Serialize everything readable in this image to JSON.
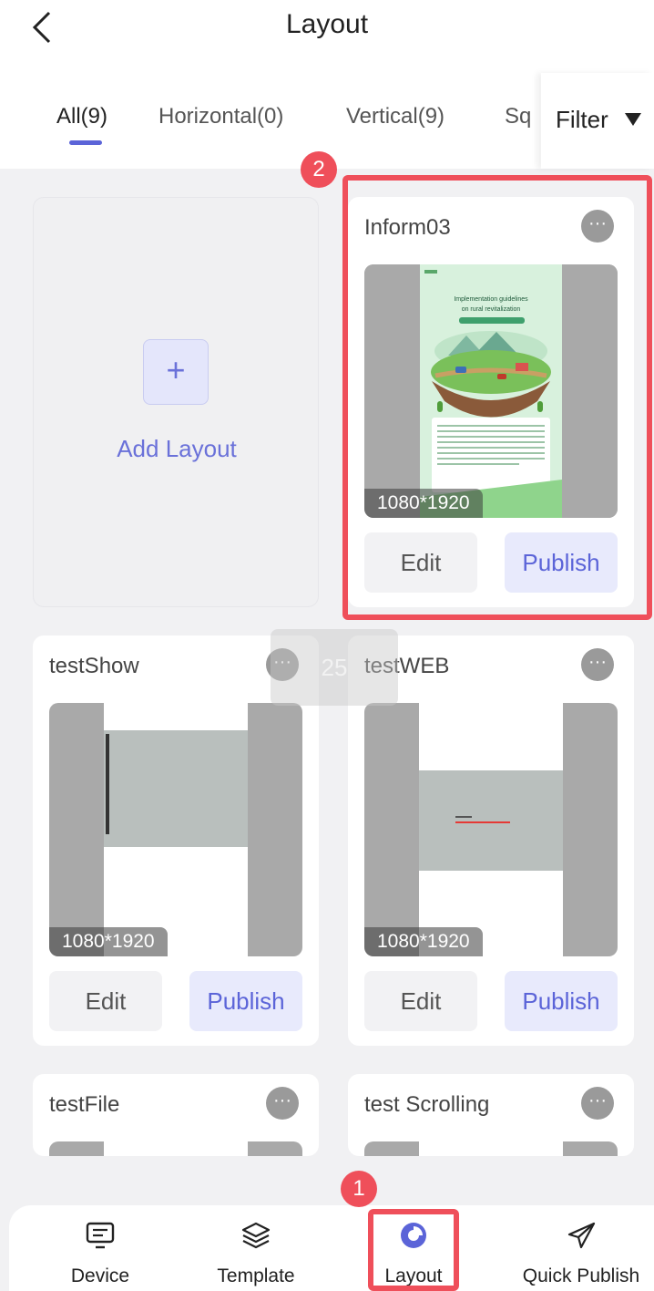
{
  "header": {
    "title": "Layout"
  },
  "tabs": [
    {
      "label": "All(9)"
    },
    {
      "label": "Horizontal(0)"
    },
    {
      "label": "Vertical(9)"
    },
    {
      "label": "Sq"
    }
  ],
  "filter": {
    "label": "Filter"
  },
  "add_layout": {
    "plus": "+",
    "label": "Add Layout"
  },
  "cards": [
    {
      "name": "Inform03",
      "resolution": "1080*1920",
      "edit": "Edit",
      "publish": "Publish",
      "more": "···"
    },
    {
      "name": "testShow",
      "resolution": "1080*1920",
      "edit": "Edit",
      "publish": "Publish",
      "more": "···"
    },
    {
      "name": "testWEB",
      "resolution": "1080*1920",
      "edit": "Edit",
      "publish": "Publish",
      "more": "···"
    },
    {
      "name": "testFile",
      "more": "···"
    },
    {
      "name": "test Scrolling",
      "more": "···"
    }
  ],
  "thumb_text": {
    "inform_title": "Implementation guidelines on rural revitalization"
  },
  "ghost": {
    "text": "25"
  },
  "nav": [
    {
      "label": "Device",
      "icon": "monitor-icon"
    },
    {
      "label": "Template",
      "icon": "layers-icon"
    },
    {
      "label": "Layout",
      "icon": "layout-icon",
      "active": true
    },
    {
      "label": "Quick Publish",
      "icon": "paper-plane-icon"
    }
  ],
  "annotations": [
    {
      "number": "1"
    },
    {
      "number": "2"
    }
  ],
  "colors": {
    "accent": "#5b64d8",
    "annotation": "#ef4f5a",
    "background": "#f1f1f3"
  }
}
